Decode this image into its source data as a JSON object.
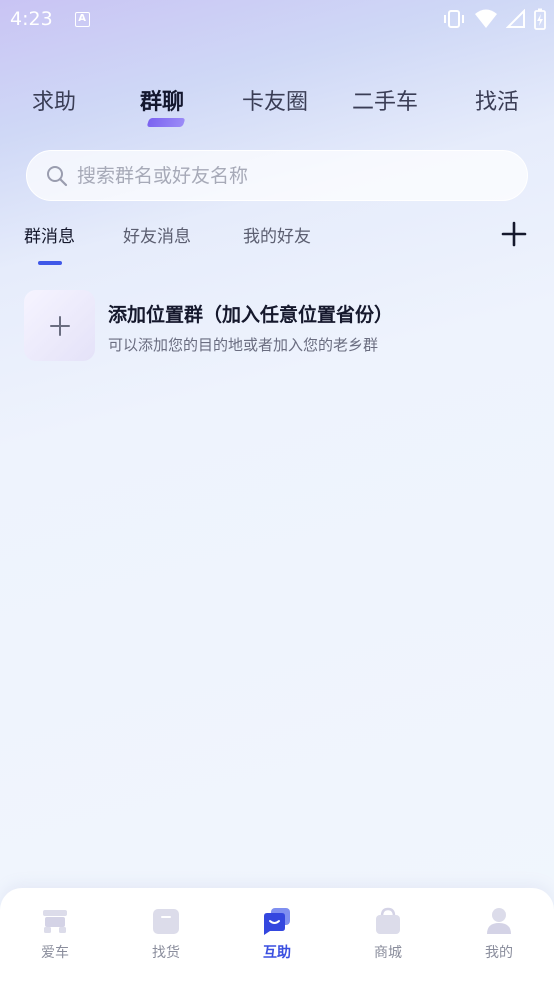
{
  "status_bar": {
    "time": "4:23",
    "notification_letter": "A"
  },
  "top_tabs": [
    {
      "label": "求助",
      "active": false
    },
    {
      "label": "群聊",
      "active": true
    },
    {
      "label": "卡友圈",
      "active": false
    },
    {
      "label": "二手车",
      "active": false
    },
    {
      "label": "找活",
      "active": false
    }
  ],
  "search": {
    "placeholder": "搜索群名或好友名称",
    "value": ""
  },
  "sub_tabs": [
    {
      "label": "群消息",
      "active": true
    },
    {
      "label": "好友消息",
      "active": false
    },
    {
      "label": "我的好友",
      "active": false
    }
  ],
  "group_entry": {
    "title": "添加位置群（加入任意位置省份）",
    "description": "可以添加您的目的地或者加入您的老乡群"
  },
  "bottom_nav": [
    {
      "label": "爱车",
      "icon": "truck-icon",
      "active": false
    },
    {
      "label": "找货",
      "icon": "box-icon",
      "active": false
    },
    {
      "label": "互助",
      "icon": "chat-icon",
      "active": true
    },
    {
      "label": "商城",
      "icon": "shopping-bag-icon",
      "active": false
    },
    {
      "label": "我的",
      "icon": "person-icon",
      "active": false
    }
  ],
  "colors": {
    "accent": "#3f58e8",
    "tab_underline": "#7b63f0",
    "inactive_icon": "#dcdcea"
  }
}
